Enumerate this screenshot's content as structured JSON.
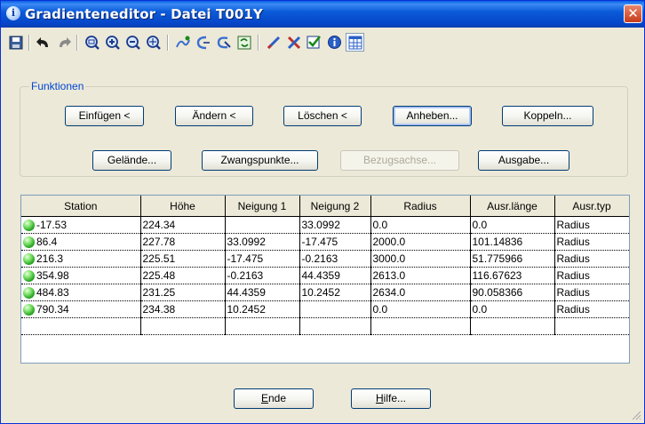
{
  "window": {
    "title": "Gradienteneditor - Datei T001Y",
    "close_symbol": "✕"
  },
  "toolbar": {
    "icons": [
      "save-icon",
      "undo-icon",
      "redo-icon",
      "zoom-window-icon",
      "zoom-in-icon",
      "zoom-out-icon",
      "zoom-all-icon",
      "add-point-icon",
      "add-curve-icon",
      "edit-curve-icon",
      "refresh-icon",
      "pen-icon",
      "delete-icon",
      "check-icon",
      "info-icon",
      "table-icon"
    ]
  },
  "functions": {
    "group_label": "Funktionen",
    "row1": [
      "Einfügen <",
      "Ändern <",
      "Löschen <",
      "Anheben...",
      "Koppeln..."
    ],
    "row2": [
      "Gelände...",
      "Zwangspunkte...",
      "Bezugsachse...",
      "Ausgabe..."
    ]
  },
  "table": {
    "columns": [
      "Station",
      "Höhe",
      "Neigung 1",
      "Neigung 2",
      "Radius",
      "Ausr.länge",
      "Ausr.typ"
    ],
    "rows": [
      [
        "-17.53",
        "224.34",
        "",
        "33.0992",
        "0.0",
        "0.0",
        "Radius"
      ],
      [
        "86.4",
        "227.78",
        "33.0992",
        "-17.475",
        "2000.0",
        "101.14836",
        "Radius"
      ],
      [
        "216.3",
        "225.51",
        "-17.475",
        "-0.2163",
        "3000.0",
        "51.775966",
        "Radius"
      ],
      [
        "354.98",
        "225.48",
        "-0.2163",
        "44.4359",
        "2613.0",
        "116.67623",
        "Radius"
      ],
      [
        "484.83",
        "231.25",
        "44.4359",
        "10.2452",
        "2634.0",
        "90.058366",
        "Radius"
      ],
      [
        "790.34",
        "234.38",
        "10.2452",
        "",
        "0.0",
        "0.0",
        "Radius"
      ],
      [
        "",
        "",
        "",
        "",
        "",
        "",
        ""
      ]
    ]
  },
  "footer": {
    "end_label_mn": "E",
    "end_label_rest": "nde",
    "help_label_mn": "H",
    "help_label_rest": "ilfe..."
  },
  "colors": {
    "titlebar": "#0b5bd9",
    "group_title": "#0046d5",
    "status_gem": "#1c9a1c"
  }
}
